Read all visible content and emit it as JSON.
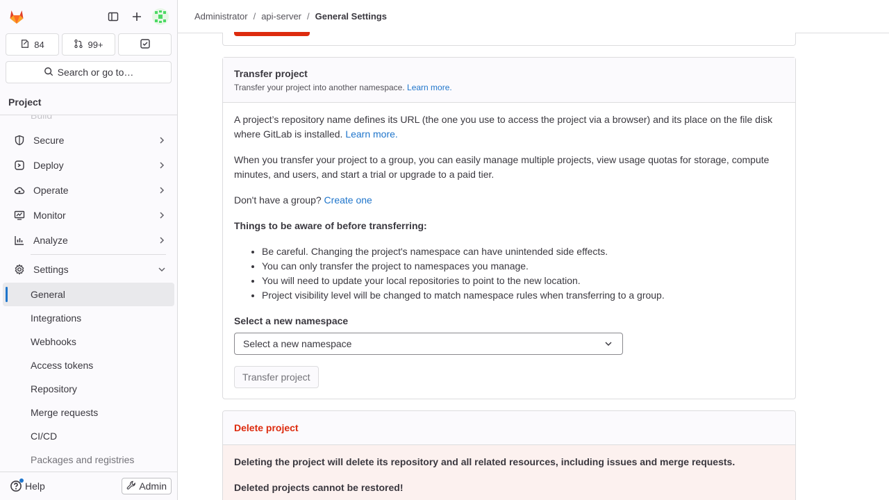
{
  "sidebar": {
    "counts": [
      {
        "icon": "issues-icon",
        "label": "84"
      },
      {
        "icon": "merge-request-icon",
        "label": "99+"
      },
      {
        "icon": "todo-icon",
        "label": ""
      }
    ],
    "search_label": "Search or go to…",
    "section_title": "Project",
    "faded_item": "Build",
    "nav_items": [
      {
        "label": "Secure",
        "icon": "shield-icon"
      },
      {
        "label": "Deploy",
        "icon": "deploy-icon"
      },
      {
        "label": "Operate",
        "icon": "cloud-icon"
      },
      {
        "label": "Monitor",
        "icon": "monitor-icon"
      },
      {
        "label": "Analyze",
        "icon": "chart-icon"
      }
    ],
    "settings_label": "Settings",
    "settings_sub": [
      "General",
      "Integrations",
      "Webhooks",
      "Access tokens",
      "Repository",
      "Merge requests",
      "CI/CD",
      "Packages and registries"
    ],
    "help_label": "Help",
    "admin_label": "Admin"
  },
  "breadcrumb": [
    "Administrator",
    "api-server",
    "General Settings"
  ],
  "transfer": {
    "title": "Transfer project",
    "subtitle": "Transfer your project into another namespace.",
    "subtitle_link": "Learn more.",
    "para1": "A project’s repository name defines its URL (the one you use to access the project via a browser) and its place on the file disk where GitLab is installed.",
    "para1_link": "Learn more.",
    "para2": "When you transfer your project to a group, you can easily manage multiple projects, view usage quotas for storage, compute minutes, and users, and start a trial or upgrade to a paid tier.",
    "para3": "Don't have a group?",
    "para3_link": "Create one",
    "aware_title": "Things to be aware of before transferring:",
    "aware_items": [
      "Be careful. Changing the project's namespace can have unintended side effects.",
      "You can only transfer the project to namespaces you manage.",
      "You will need to update your local repositories to point to the new location.",
      "Project visibility level will be changed to match namespace rules when transferring to a group."
    ],
    "namespace_label": "Select a new namespace",
    "namespace_value": "Select a new namespace",
    "button": "Transfer project"
  },
  "delete": {
    "title": "Delete project",
    "line1": "Deleting the project will delete its repository and all related resources, including issues and merge requests.",
    "line2": "Deleted projects cannot be restored!"
  },
  "colors": {
    "accent": "#1f75cb",
    "danger": "#dd2b0e",
    "danger_bg": "#fcf1ef"
  }
}
